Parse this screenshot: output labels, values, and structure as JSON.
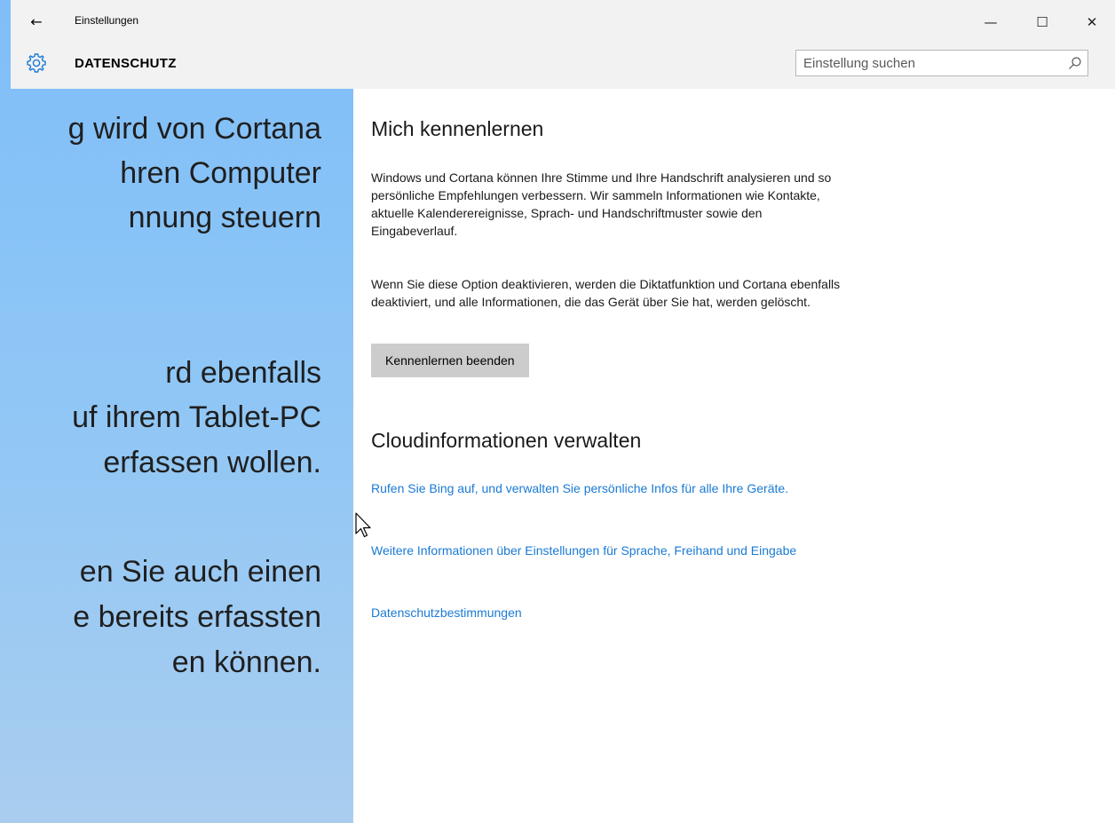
{
  "background_slide": {
    "lines": [
      "g wird von Cortana",
      "hren Computer",
      "nnung steuern",
      "rd ebenfalls",
      "uf ihrem Tablet-PC",
      "erfassen wollen.",
      "en Sie auch einen",
      "e bereits erfassten",
      "en können."
    ]
  },
  "window": {
    "app_title": "Einstellungen",
    "back_glyph": "←",
    "minimize_glyph": "—",
    "maximize_glyph": "☐",
    "close_glyph": "✕",
    "page_title": "DATENSCHUTZ",
    "search": {
      "placeholder": "Einstellung suchen",
      "value": ""
    }
  },
  "content": {
    "section1": {
      "title": "Mich kennenlernen",
      "para1": "Windows und Cortana können Ihre Stimme und Ihre Handschrift analysieren und so persönliche Empfehlungen verbessern. Wir sammeln Informationen wie Kontakte, aktuelle Kalenderereignisse, Sprach- und Handschriftmuster sowie den Eingabeverlauf.",
      "para2": "Wenn Sie diese Option deaktivieren, werden die Diktatfunktion und Cortana ebenfalls deaktiviert, und alle Informationen, die das Gerät über Sie hat, werden gelöscht.",
      "button": "Kennenlernen beenden"
    },
    "section2": {
      "title": "Cloudinformationen verwalten",
      "link1": "Rufen Sie Bing auf, und verwalten Sie persönliche Infos für alle Ihre Geräte.",
      "link2": "Weitere Informationen über Einstellungen für Sprache, Freihand und Eingabe",
      "link3": "Datenschutzbestimmungen"
    }
  },
  "colors": {
    "link": "#1a7ad4",
    "titlebar_bg": "#f2f2f2",
    "button_bg": "#cccccc",
    "background_gradient_top": "#7fbef8"
  },
  "icons": {
    "gear": "gear-icon",
    "search": "search-icon",
    "back": "back-arrow-icon",
    "cursor": "mouse-pointer-icon"
  }
}
